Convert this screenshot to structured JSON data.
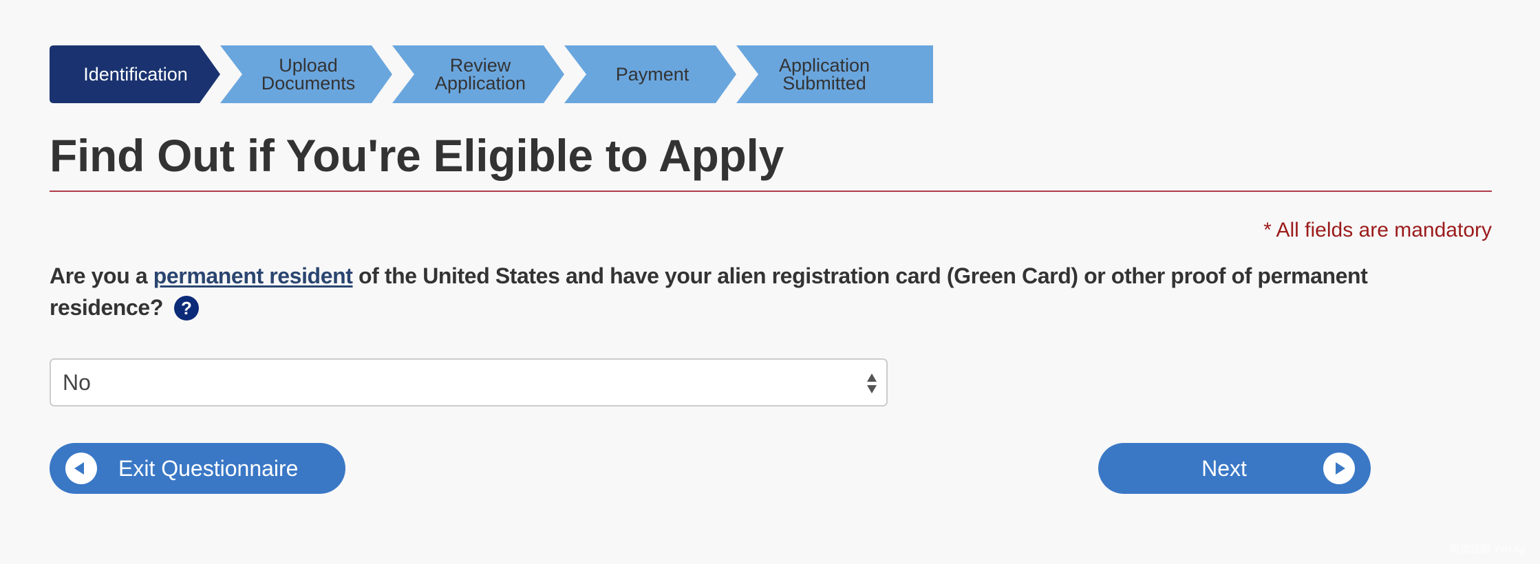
{
  "stepper": {
    "steps": [
      {
        "label": "Identification",
        "active": true
      },
      {
        "label": "Upload\nDocuments",
        "active": false
      },
      {
        "label": "Review\nApplication",
        "active": false
      },
      {
        "label": "Payment",
        "active": false
      },
      {
        "label": "Application\nSubmitted",
        "active": false
      }
    ],
    "colors": {
      "active": "#1a3370",
      "inactive": "#6aa6de"
    }
  },
  "page": {
    "title": "Find Out if You're Eligible to Apply",
    "mandatory_note": "* All fields are mandatory"
  },
  "question": {
    "text_before_link": "Are you a ",
    "link_text": "permanent resident",
    "text_after_link": " of the United States and have your alien registration card (Green Card) or other proof of permanent residence?",
    "help_icon": "question-circle-icon",
    "help_symbol": "?"
  },
  "answer_select": {
    "selected_value": "No"
  },
  "buttons": {
    "exit_label": "Exit Questionnaire",
    "exit_icon": "chevron-left-circle-icon",
    "next_label": "Next",
    "next_icon": "chevron-right-circle-icon"
  },
  "watermark": "新加坡眼 Yan.sg"
}
